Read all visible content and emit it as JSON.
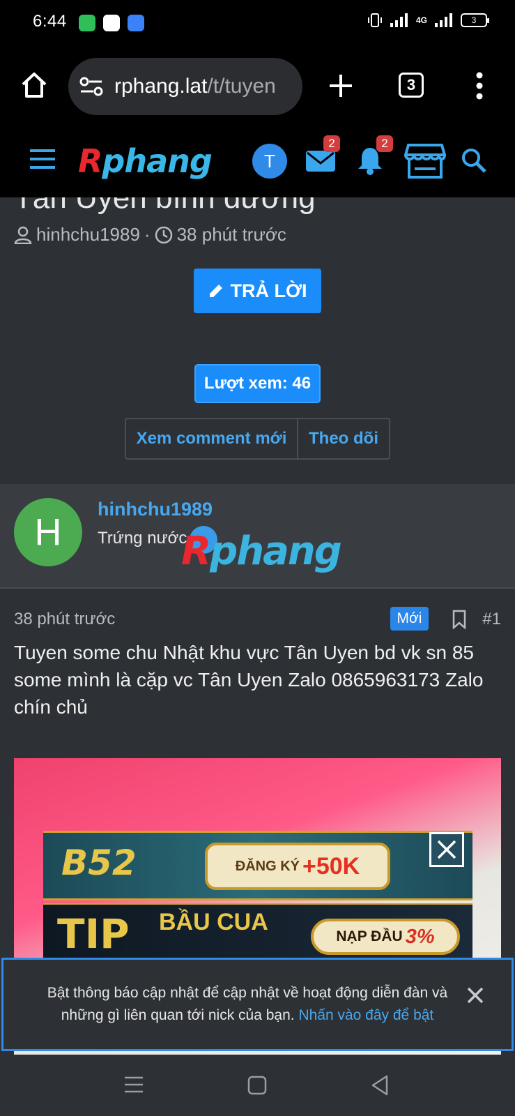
{
  "status_bar": {
    "time": "6:44",
    "network": "4G",
    "battery": "3",
    "apps": [
      "battery-saver-icon",
      "zalo-icon",
      "messenger-icon"
    ]
  },
  "browser": {
    "url_host": "rphang.lat",
    "url_path": "/t/tuyen",
    "tab_count": "3"
  },
  "forum_header": {
    "logo_r": "R",
    "logo_rest": "phang",
    "user_initial": "T",
    "inbox_badge": "2",
    "alerts_badge": "2"
  },
  "thread": {
    "title": "Tân Uyên bình dương",
    "author": "hinhchu1989",
    "time": "38 phút trước",
    "reply_label": "TRẢ LỜI",
    "views_label": "Lượt xem: 46",
    "btn_latest": "Xem comment mới",
    "btn_follow": "Theo dõi"
  },
  "post": {
    "avatar_letter": "H",
    "username": "hinhchu1989",
    "user_title": "Trứng nước",
    "watermark_r": "R",
    "watermark_rest": "phang",
    "time": "38 phút trước",
    "new_badge": "Mới",
    "number": "#1",
    "body": "Tuyen some chu Nhật khu vực Tân Uyen bd vk sn 85 some mình là cặp vc Tân Uyen Zalo 0865963173 Zalo chín chủ"
  },
  "ads": {
    "b52_logo": "B52",
    "register_text": "ĐĂNG KÝ",
    "register_bonus": "+50K",
    "tip_logo": "TIP",
    "bau_cua": "BẦU CUA",
    "nap_dau": "NẠP ĐẦU",
    "nap_percent": "3%"
  },
  "notice": {
    "text": "Bật thông báo cập nhật để cập nhật về hoạt động diễn đàn và những gì liên quan tới nick của bạn.",
    "link": "Nhấn vào đây để bật"
  },
  "colors": {
    "accent": "#1b8dfa",
    "link": "#47a8f0",
    "background": "#2d3135",
    "avatar_green": "#4cab50"
  }
}
